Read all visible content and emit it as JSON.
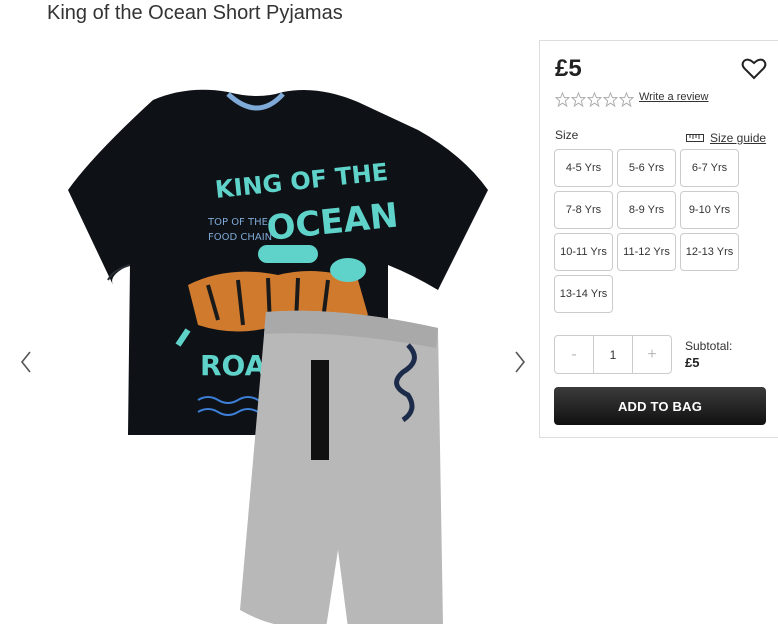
{
  "product": {
    "title": "King of the Ocean Short Pyjamas",
    "price": "£5",
    "write_review": "Write a review",
    "rating_stars": 5,
    "colors": {
      "accent_dark": "#222222",
      "tshirt": "#0e1116",
      "tshirt_text": "#5fd3c9",
      "shorts": "#b8b8b8"
    }
  },
  "gallery": {
    "prev_icon": "chevron-left-icon",
    "next_icon": "chevron-right-icon"
  },
  "size": {
    "label": "Size",
    "guide_label": "Size guide",
    "options": [
      "4-5 Yrs",
      "5-6 Yrs",
      "6-7 Yrs",
      "7-8 Yrs",
      "8-9 Yrs",
      "9-10 Yrs",
      "10-11 Yrs",
      "11-12 Yrs",
      "12-13 Yrs",
      "13-14 Yrs"
    ]
  },
  "quantity": {
    "minus": "-",
    "value": "1",
    "plus": "+"
  },
  "subtotal": {
    "label": "Subtotal:",
    "value": "£5"
  },
  "cart": {
    "add_label": "ADD TO BAG"
  }
}
